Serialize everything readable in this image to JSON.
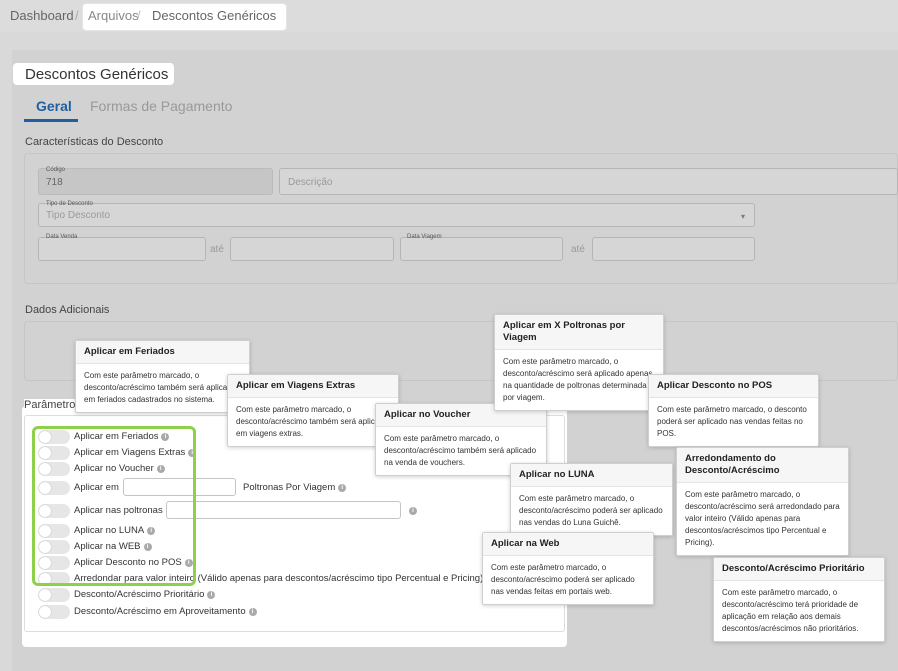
{
  "breadcrumb": {
    "dashboard": "Dashboard",
    "sep1": "/",
    "arquivos": "Arquivos",
    "sep2": "/",
    "current": "Descontos Genéricos"
  },
  "page_title": "Descontos Genéricos",
  "tabs": [
    {
      "label": "Geral",
      "active": true
    },
    {
      "label": "Formas de Pagamento",
      "active": false
    }
  ],
  "caracteristicas": {
    "title": "Características do Desconto",
    "codigo_label": "Código",
    "codigo_value": "718",
    "descricao_placeholder": "Descrição",
    "tipo_label": "Tipo de Desconto",
    "tipo_value": "Tipo Desconto",
    "data_venda_label": "Data Venda",
    "ate1": "até",
    "data_viagem_label": "Data Viagem",
    "ate2": "até"
  },
  "dados_adicionais": {
    "title": "Dados Adicionais"
  },
  "parametros": {
    "title": "Parâmetro",
    "info_icon": "i",
    "options": [
      {
        "label": "Aplicar em Feriados"
      },
      {
        "label": "Aplicar em Viagens Extras"
      },
      {
        "label": "Aplicar no Voucher"
      },
      {
        "label": "Aplicar em",
        "suffix": "Poltronas Por Viagem"
      },
      {
        "label": "Aplicar nas poltronas"
      },
      {
        "label": "Aplicar no LUNA"
      },
      {
        "label": "Aplicar na WEB"
      },
      {
        "label": "Aplicar Desconto no POS"
      },
      {
        "label": "Arredondar para valor inteiro (Válido apenas para descontos/acréscimo tipo Percentual e Pricing)"
      },
      {
        "label": "Desconto/Acréscimo Prioritário"
      },
      {
        "label": "Desconto/Acréscimo em Aproveitamento"
      }
    ]
  },
  "tooltips": {
    "feriados": {
      "title": "Aplicar em Feriados",
      "body": "Com este parâmetro marcado, o desconto/acréscimo também será aplicado em feriados cadastrados no sistema."
    },
    "viagens_extras": {
      "title": "Aplicar em Viagens Extras",
      "body": "Com este parâmetro marcado, o desconto/acréscimo também será aplicado em viagens extras."
    },
    "voucher": {
      "title": "Aplicar no Voucher",
      "body": "Com este parâmetro marcado, o desconto/acréscimo também será aplicado na venda de vouchers."
    },
    "x_poltronas": {
      "title": "Aplicar em X Poltronas por Viagem",
      "body": "Com este parâmetro marcado, o desconto/acréscimo será aplicado apenas na quantidade de poltronas determinada por viagem."
    },
    "pos": {
      "title": "Aplicar Desconto no POS",
      "body": "Com este parâmetro marcado, o desconto poderá ser aplicado nas vendas feitas no POS."
    },
    "luna": {
      "title": "Aplicar no LUNA",
      "body": "Com este parâmetro marcado, o desconto/acréscimo poderá ser aplicado nas vendas do Luna Guichê."
    },
    "arredondamento": {
      "title": "Arredondamento do Desconto/Acréscimo",
      "body": "Com este parâmetro marcado, o desconto/acréscimo será arredondado para valor inteiro (Válido apenas para descontos/acréscimos tipo Percentual e Pricing)."
    },
    "web": {
      "title": "Aplicar na Web",
      "body": "Com este parâmetro marcado, o desconto/acréscimo poderá ser aplicado nas vendas feitas em portais web."
    },
    "prioritario": {
      "title": "Desconto/Acréscimo Prioritário",
      "body": "Com este parâmetro marcado, o desconto/acréscimo terá prioridade de aplicação em relação aos demais descontos/acréscimos não prioritários."
    }
  },
  "colors": {
    "accent": "#1f5f9f",
    "highlight": "#8ed04a"
  }
}
